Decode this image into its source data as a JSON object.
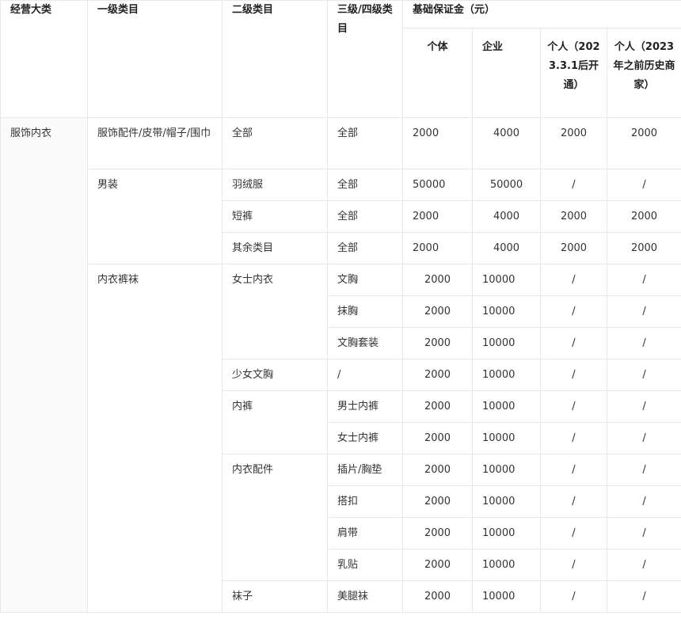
{
  "headers": {
    "category": "经营大类",
    "level1": "一级类目",
    "level2": "二级类目",
    "level34": "三级/四级类目",
    "deposit_group": "基础保证金（元）",
    "individual": "个体",
    "enterprise": "企业",
    "personal_new": "个人（2023.3.1后开通）",
    "personal_old": "个人（2023年之前历史商家）"
  },
  "rows": [
    {
      "l3": "全部",
      "ind": "2000",
      "ent": "4000",
      "pnew": "2000",
      "pold": "2000"
    },
    {
      "l3": "全部",
      "ind": "50000",
      "ent": "50000",
      "pnew": "/",
      "pold": "/"
    },
    {
      "l3": "全部",
      "ind": "2000",
      "ent": "4000",
      "pnew": "2000",
      "pold": "2000"
    },
    {
      "l3": "全部",
      "ind": "2000",
      "ent": "4000",
      "pnew": "2000",
      "pold": "2000"
    },
    {
      "l3": "文胸",
      "ind": "2000",
      "ent": "10000",
      "pnew": "/",
      "pold": "/"
    },
    {
      "l3": "抹胸",
      "ind": "2000",
      "ent": "10000",
      "pnew": "/",
      "pold": "/"
    },
    {
      "l3": "文胸套装",
      "ind": "2000",
      "ent": "10000",
      "pnew": "/",
      "pold": "/"
    },
    {
      "l3": "/",
      "ind": "2000",
      "ent": "10000",
      "pnew": "/",
      "pold": "/"
    },
    {
      "l3": "男士内裤",
      "ind": "2000",
      "ent": "10000",
      "pnew": "/",
      "pold": "/"
    },
    {
      "l3": "女士内裤",
      "ind": "2000",
      "ent": "10000",
      "pnew": "/",
      "pold": "/"
    },
    {
      "l3": "插片/胸垫",
      "ind": "2000",
      "ent": "10000",
      "pnew": "/",
      "pold": "/"
    },
    {
      "l3": "搭扣",
      "ind": "2000",
      "ent": "10000",
      "pnew": "/",
      "pold": "/"
    },
    {
      "l3": "肩带",
      "ind": "2000",
      "ent": "10000",
      "pnew": "/",
      "pold": "/"
    },
    {
      "l3": "乳贴",
      "ind": "2000",
      "ent": "10000",
      "pnew": "/",
      "pold": "/"
    },
    {
      "l3": "美腿袜",
      "ind": "2000",
      "ent": "10000",
      "pnew": "/",
      "pold": "/"
    }
  ],
  "category": {
    "name": "服饰内衣"
  },
  "level1": {
    "accessories": "服饰配件/皮带/帽子/围巾",
    "menswear": "男装",
    "underwear": "内衣裤袜"
  },
  "level2": {
    "all": "全部",
    "down_jacket": "羽绒服",
    "shorts": "短裤",
    "others": "其余类目",
    "women_underwear": "女士内衣",
    "girl_bra": "少女文胸",
    "panties": "内裤",
    "underwear_accessories": "内衣配件",
    "socks": "袜子"
  }
}
